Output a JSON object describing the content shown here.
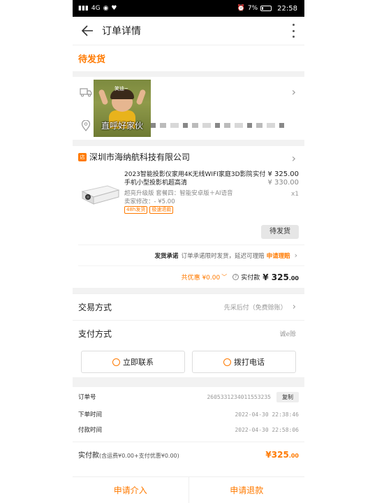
{
  "status_bar": {
    "network": "4G",
    "battery": "7%",
    "time": "22:58"
  },
  "nav": {
    "title": "订单详情"
  },
  "order": {
    "status": "待发货"
  },
  "address": {
    "sticker_small_text": "笑迪~",
    "sticker_caption": "直呼好家伙"
  },
  "store": {
    "icon_text": "店",
    "name": "深圳市海纳航科技有限公司"
  },
  "product": {
    "title": "2023智能投影仪家用4K无线WIFI家庭3D影院手机小型投影机超高清",
    "paid_label": "实付",
    "paid_price": "¥ 325.00",
    "original_price": "¥ 330.00",
    "qty": "x1",
    "spec": "超亮升级版 套餐四：智能安卓版＋AI语音",
    "seller_edit": "卖家修改：- ¥5.00",
    "tags": [
      "48h发货",
      "极速退款"
    ],
    "ship_status_button": "待发货"
  },
  "promise": {
    "label": "发货承诺",
    "text": "订单承诺限时发货，延迟可理赔",
    "link": "申请理赔"
  },
  "totals": {
    "discount": "共优惠 ¥0.00",
    "paid_label": "实付款",
    "paid_main": "¥ 325",
    "paid_decimal": ".00"
  },
  "trade": {
    "label": "交易方式",
    "value": "先采后付（免费赊账）"
  },
  "payment": {
    "label": "支付方式",
    "value": "诚e赊"
  },
  "actions": {
    "contact": "立即联系",
    "call": "拨打电话"
  },
  "info": {
    "order_no_label": "订单号",
    "order_no": "2605331234011553235",
    "copy": "复制",
    "order_time_label": "下单时间",
    "order_time": "2022-04-30 22:38:46",
    "pay_time_label": "付款时间",
    "pay_time": "2022-04-30 22:58:06"
  },
  "paid_total": {
    "label": "实付款",
    "detail": "(含运费¥0.00+支付优惠¥0.00)",
    "amount": "¥325",
    "decimal": ".00"
  },
  "footer": {
    "intervene": "申请介入",
    "refund": "申请退款"
  }
}
